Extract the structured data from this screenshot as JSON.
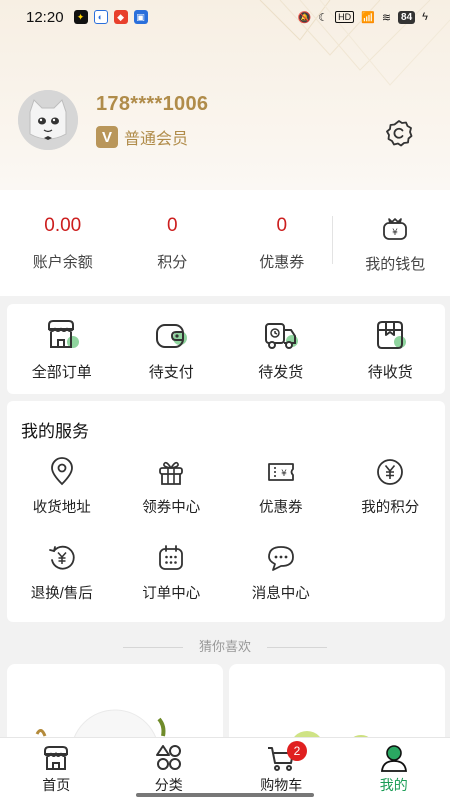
{
  "status_bar": {
    "time": "12:20",
    "battery": "84"
  },
  "profile": {
    "phone": "178****1006",
    "level": "普通会员"
  },
  "balance": {
    "items": [
      {
        "value": "0.00",
        "label": "账户余额"
      },
      {
        "value": "0",
        "label": "积分"
      },
      {
        "value": "0",
        "label": "优惠券"
      }
    ],
    "wallet_label": "我的钱包"
  },
  "orders": [
    {
      "label": "全部订单",
      "icon": "shop-icon"
    },
    {
      "label": "待支付",
      "icon": "wallet-icon"
    },
    {
      "label": "待发货",
      "icon": "truck-icon"
    },
    {
      "label": "待收货",
      "icon": "box-icon"
    }
  ],
  "services": {
    "title": "我的服务",
    "items": [
      {
        "label": "收货地址",
        "icon": "location-icon"
      },
      {
        "label": "领券中心",
        "icon": "gift-icon"
      },
      {
        "label": "优惠券",
        "icon": "coupon-icon"
      },
      {
        "label": "我的积分",
        "icon": "yen-icon"
      },
      {
        "label": "退换/售后",
        "icon": "refund-icon"
      },
      {
        "label": "订单中心",
        "icon": "calendar-icon"
      },
      {
        "label": "消息中心",
        "icon": "chat-icon"
      }
    ]
  },
  "guess_title": "猜你喜欢",
  "tabbar": {
    "items": [
      {
        "label": "首页",
        "icon": "home-store-icon"
      },
      {
        "label": "分类",
        "icon": "category-icon"
      },
      {
        "label": "购物车",
        "icon": "cart-icon"
      },
      {
        "label": "我的",
        "icon": "person-icon"
      }
    ],
    "cart_badge": "2",
    "active": "我的"
  },
  "colors": {
    "accent_green": "#1a9c55",
    "gold": "#b08c4a",
    "red": "#cc1e1e"
  }
}
